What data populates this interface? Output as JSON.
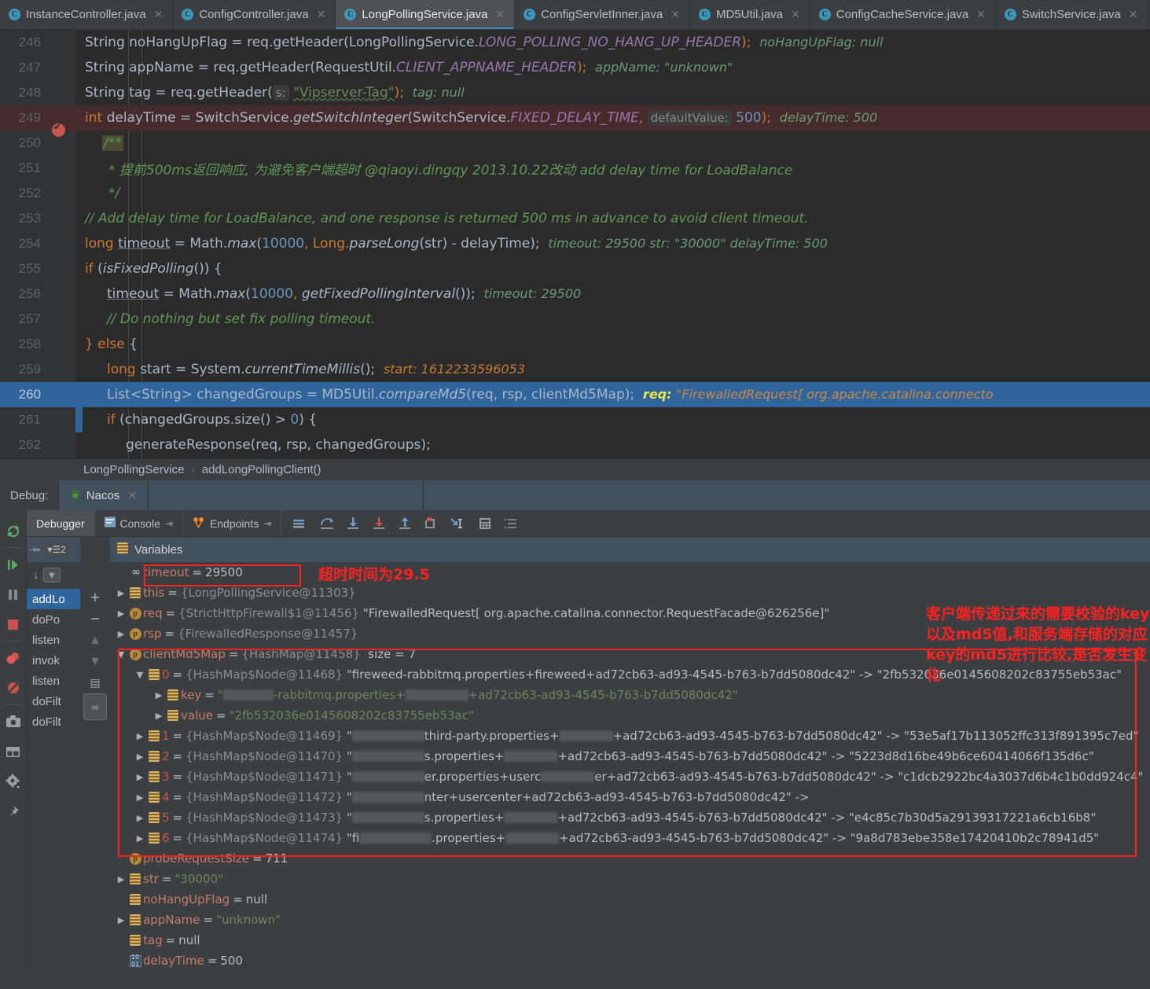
{
  "editor_tabs": [
    {
      "label": "InstanceController.java",
      "selected": false
    },
    {
      "label": "ConfigController.java",
      "selected": false
    },
    {
      "label": "LongPollingService.java",
      "selected": true
    },
    {
      "label": "ConfigServletInner.java",
      "selected": false
    },
    {
      "label": "MD5Util.java",
      "selected": false
    },
    {
      "label": "ConfigCacheService.java",
      "selected": false
    },
    {
      "label": "SwitchService.java",
      "selected": false
    }
  ],
  "code_lines": [
    {
      "num": "246"
    },
    {
      "num": "247"
    },
    {
      "num": "248"
    },
    {
      "num": "249"
    },
    {
      "num": "250"
    },
    {
      "num": "251"
    },
    {
      "num": "252"
    },
    {
      "num": "253"
    },
    {
      "num": "254"
    },
    {
      "num": "255"
    },
    {
      "num": "256"
    },
    {
      "num": "257"
    },
    {
      "num": "258"
    },
    {
      "num": "259"
    },
    {
      "num": "260"
    },
    {
      "num": "261"
    },
    {
      "num": "262"
    }
  ],
  "code": {
    "l246": {
      "t1": "String noHangUpFlag = req.getHeader(LongPollingService.",
      "f1": "LONG_POLLING_NO_HANG_UP_HEADER",
      "t2": ");",
      "hint": "noHangUpFlag: null"
    },
    "l247": {
      "t1": "String appName = req.getHeader(RequestUtil.",
      "f1": "CLIENT_APPNAME_HEADER",
      "t2": ");",
      "hint": "appName: \"unknown\""
    },
    "l248": {
      "t1": "String tag = req.getHeader(",
      "param": "s:",
      "str": "\"Vipserver-Tag\"",
      "t2": ");",
      "hint": "tag: null"
    },
    "l249": {
      "kw": "int",
      "t1": " delayTime = SwitchService.",
      "m1": "getSwitchInteger",
      "t2": "(SwitchService.",
      "f1": "FIXED_DELAY_TIME",
      "t3": ",",
      "param": "defaultValue:",
      "num": "500",
      "t4": ");",
      "hint": "delayTime: 500"
    },
    "l250": {
      "c": "/**"
    },
    "l251": {
      "c": "* 提前500ms返回响应, 为避免客户端超时 @qiaoyi.dingqy 2013.10.22改动 add delay time for LoadBalance"
    },
    "l252": {
      "c": "*/"
    },
    "l253": {
      "c": "// Add delay time for LoadBalance, and one response is returned 500 ms in advance to avoid client timeout."
    },
    "l254": {
      "kw": "long",
      "var": "timeout",
      "t1": " = Math.",
      "m1": "max",
      "t2": "(",
      "n1": "10000",
      "t3": ", Long.",
      "m2": "parseLong",
      "t4": "(str) - delayTime);",
      "hint": "timeout: 29500   str: \"30000\"   delayTime: 500"
    },
    "l255": {
      "kw": "if",
      "t1": " (",
      "m1": "isFixedPolling",
      "t2": "()) {"
    },
    "l256": {
      "var": "timeout",
      "t1": " = Math.",
      "m1": "max",
      "t2": "(",
      "n1": "10000",
      "t3": ", ",
      "m2": "getFixedPollingInterval",
      "t4": "());",
      "hint": "timeout: 29500"
    },
    "l257": {
      "c": "// Do nothing but set fix polling timeout."
    },
    "l258": {
      "t1": "} ",
      "kw": "else",
      "t2": " {"
    },
    "l259": {
      "kw": "long",
      "t1": " start = System.",
      "m1": "currentTimeMillis",
      "t2": "();",
      "hint": "start: 1612233596053"
    },
    "l260": {
      "t1": "List<String> changedGroups = MD5Util.",
      "m1": "compareMd5",
      "t2": "(req, rsp, clientMd5Map);",
      "hintlabel": "req:",
      "hint": "\"FirewalledRequest[ org.apache.catalina.connecto"
    },
    "l261": {
      "kw": "if",
      "t1": " (changedGroups.size() > ",
      "n1": "0",
      "t2": ") {"
    },
    "l262": {
      "t1": "generateResponse(req, rsp, changedGroups);"
    }
  },
  "breadcrumb": {
    "class": "LongPollingService",
    "separator": "›",
    "method": "addLongPollingClient()"
  },
  "debug_header": {
    "label": "Debug:",
    "session": "Nacos"
  },
  "debug_tabs": [
    {
      "label": "Debugger",
      "selected": true,
      "icon": ""
    },
    {
      "label": "Console",
      "selected": false,
      "icon": "console-icon"
    },
    {
      "label": "Endpoints",
      "selected": false,
      "icon": "endpoints-icon"
    }
  ],
  "toolbar_icons": [
    "show-execution-point-icon",
    "step-over-icon",
    "step-into-icon",
    "force-step-into-icon",
    "step-out-icon",
    "drop-frame-icon",
    "run-to-cursor-icon",
    "evaluate-expression-icon",
    "settings-list-icon"
  ],
  "left_rail_icons": [
    "rerun-icon",
    "resume-program-icon",
    "pause-program-icon",
    "stop-icon",
    "view-breakpoints-icon",
    "mute-breakpoints-icon",
    "screenshot-icon",
    "layout-icon",
    "settings-icon",
    "pin-icon"
  ],
  "frames": {
    "threads_count": "2",
    "items": [
      {
        "label": "addLo",
        "selected": true
      },
      {
        "label": "doPo",
        "selected": false
      },
      {
        "label": "listen",
        "selected": false
      },
      {
        "label": "invok",
        "selected": false
      },
      {
        "label": "listen",
        "selected": false
      },
      {
        "label": "doFilt",
        "selected": false
      },
      {
        "label": "doFilt",
        "selected": false
      }
    ]
  },
  "variables_panel": {
    "title": "Variables",
    "rows": [
      {
        "indent": 0,
        "arrow": "",
        "icon": "infinity-icon",
        "name": "timeout",
        "eq": " = ",
        "value": "29500",
        "value_kind": "plain",
        "boxed": true
      },
      {
        "indent": 0,
        "arrow": "▶",
        "icon": "stack-icon",
        "name": "this",
        "eq": " = ",
        "value": "{LongPollingService@11303}",
        "value_kind": "ref"
      },
      {
        "indent": 0,
        "arrow": "▶",
        "icon": "p-icon",
        "name": "req",
        "eq": " = ",
        "value": "{StrictHttpFirewall$1@11456}",
        "value_kind": "ref",
        "extra": "\"FirewalledRequest[ org.apache.catalina.connector.RequestFacade@626256e]\""
      },
      {
        "indent": 0,
        "arrow": "▶",
        "icon": "p-icon",
        "name": "rsp",
        "eq": " = ",
        "value": "{FirewalledResponse@11457}",
        "value_kind": "ref"
      },
      {
        "indent": 0,
        "arrow": "▼",
        "icon": "p-icon",
        "name": "clientMd5Map",
        "eq": " = ",
        "value": "{HashMap@11458}",
        "value_kind": "ref",
        "extra_plain": "size = 7"
      },
      {
        "indent": 1,
        "arrow": "▼",
        "icon": "stack-icon",
        "name": "0",
        "name_kind": "num",
        "eq": " = ",
        "value": "{HashMap$Node@11468}",
        "value_kind": "ref",
        "extra": "\"fireweed-rabbitmq.properties+fireweed+ad72cb63-ad93-4545-b763-b7dd5080dc42\" -> \"2fb532036e0145608202c83755eb53ac\""
      },
      {
        "indent": 2,
        "arrow": "▶",
        "icon": "stack-icon",
        "name": "key",
        "eq": " = ",
        "value": "\"",
        "value_kind": "redact-key",
        "redact_tail": "-rabbitmq.properties+",
        "redact_tail2": "+ad72cb63-ad93-4545-b763-b7dd5080dc42\""
      },
      {
        "indent": 2,
        "arrow": "▶",
        "icon": "stack-icon",
        "name": "value",
        "eq": " = ",
        "value": "\"2fb532036e0145608202c83755eb53ac\"",
        "value_kind": "str"
      },
      {
        "indent": 1,
        "arrow": "▶",
        "icon": "stack-icon",
        "name": "1",
        "name_kind": "num",
        "eq": " = ",
        "value": "{HashMap$Node@11469}",
        "value_kind": "ref",
        "redacted": true,
        "seg1": "\"",
        "seg2": "third-party.properties+",
        "seg3": "+ad72cb63-ad93-4545-b763-b7dd5080dc42\" -> \"53e5af17b113052ffc313f891395c7ed\""
      },
      {
        "indent": 1,
        "arrow": "▶",
        "icon": "stack-icon",
        "name": "2",
        "name_kind": "num",
        "eq": " = ",
        "value": "{HashMap$Node@11470}",
        "value_kind": "ref",
        "redacted": true,
        "seg1": "\"",
        "seg2": "s.properties+",
        "seg3": "+ad72cb63-ad93-4545-b763-b7dd5080dc42\" -> \"5223d8d16be49b6ce60414066f135d6c\""
      },
      {
        "indent": 1,
        "arrow": "▶",
        "icon": "stack-icon",
        "name": "3",
        "name_kind": "num",
        "eq": " = ",
        "value": "{HashMap$Node@11471}",
        "value_kind": "ref",
        "redacted": true,
        "seg1": "\"",
        "seg2": "er.properties+userc",
        "seg3": "er+ad72cb63-ad93-4545-b763-b7dd5080dc42\" -> \"c1dcb2922bc4a3037d6b4c1b0dd924c4\""
      },
      {
        "indent": 1,
        "arrow": "▶",
        "icon": "stack-icon",
        "name": "4",
        "name_kind": "num",
        "eq": " = ",
        "value": "{HashMap$Node@11472}",
        "value_kind": "ref",
        "redacted": true,
        "seg1": "\"",
        "seg2": "nter+usercenter+ad72cb63-ad93-4545-b763-b7dd5080dc42\" ->",
        "seg3": ""
      },
      {
        "indent": 1,
        "arrow": "▶",
        "icon": "stack-icon",
        "name": "5",
        "name_kind": "num",
        "eq": " = ",
        "value": "{HashMap$Node@11473}",
        "value_kind": "ref",
        "redacted": true,
        "seg1": "\"",
        "seg2": "s.properties+",
        "seg3": "+ad72cb63-ad93-4545-b763-b7dd5080dc42\" -> \"e4c85c7b30d5a29139317221a6cb16b8\""
      },
      {
        "indent": 1,
        "arrow": "▶",
        "icon": "stack-icon",
        "name": "6",
        "name_kind": "num",
        "eq": " = ",
        "value": "{HashMap$Node@11474}",
        "value_kind": "ref",
        "redacted": true,
        "seg1": "\"fi",
        "seg2": ".properties+",
        "seg3": "+ad72cb63-ad93-4545-b763-b7dd5080dc42\" -> \"9a8d783ebe358e17420410b2c78941d5\""
      },
      {
        "indent": 0,
        "arrow": "",
        "icon": "p-icon",
        "name": "probeRequestSize",
        "eq": " = ",
        "value": "711",
        "value_kind": "plain"
      },
      {
        "indent": 0,
        "arrow": "▶",
        "icon": "stack-icon",
        "name": "str",
        "eq": " = ",
        "value": "\"30000\"",
        "value_kind": "str"
      },
      {
        "indent": 0,
        "arrow": "",
        "icon": "stack-icon",
        "name": "noHangUpFlag",
        "eq": " = ",
        "value": "null",
        "value_kind": "null"
      },
      {
        "indent": 0,
        "arrow": "▶",
        "icon": "stack-icon",
        "name": "appName",
        "eq": " = ",
        "value": "\"unknown\"",
        "value_kind": "str"
      },
      {
        "indent": 0,
        "arrow": "",
        "icon": "stack-icon",
        "name": "tag",
        "eq": " = ",
        "value": "null",
        "value_kind": "null"
      },
      {
        "indent": 0,
        "arrow": "",
        "icon": "int-icon",
        "name": "delayTime",
        "eq": " = ",
        "value": "500",
        "value_kind": "plain"
      }
    ]
  },
  "annotations": {
    "timeout_note": "超时时间为29.5",
    "md5_note_line1": "客户端传递过来的需要校验的key",
    "md5_note_line2": "以及md5值,和服务端存储的对应",
    "md5_note_line3": "key的md5进行比较,是否发生变化",
    "color": "#ff2020"
  }
}
